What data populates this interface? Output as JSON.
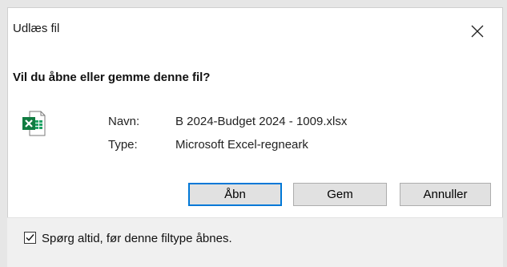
{
  "dialog": {
    "title": "Udlæs fil",
    "question": "Vil du åbne eller gemme denne fil?",
    "name_label": "Navn:",
    "name_value": "B 2024-Budget 2024 - 1009.xlsx",
    "type_label": "Type:",
    "type_value": "Microsoft Excel-regneark",
    "file_icon": "excel-file-icon",
    "buttons": {
      "open": "Åbn",
      "save": "Gem",
      "cancel": "Annuller"
    },
    "checkbox": {
      "label": "Spørg altid, før denne filtype åbnes.",
      "checked": true
    }
  },
  "colors": {
    "accent": "#0078d7",
    "excel_green": "#107c41"
  }
}
